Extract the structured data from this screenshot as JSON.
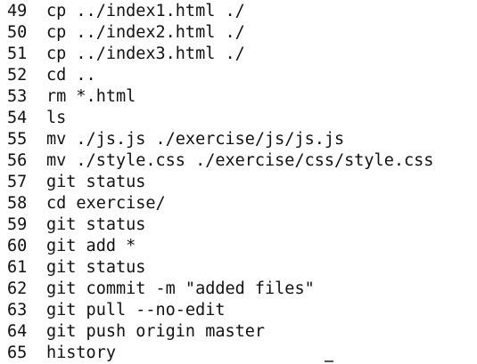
{
  "history": [
    {
      "num": "49",
      "cmd": "cp ../index1.html ./"
    },
    {
      "num": "50",
      "cmd": "cp ../index2.html ./"
    },
    {
      "num": "51",
      "cmd": "cp ../index3.html ./"
    },
    {
      "num": "52",
      "cmd": "cd .."
    },
    {
      "num": "53",
      "cmd": "rm *.html"
    },
    {
      "num": "54",
      "cmd": "ls"
    },
    {
      "num": "55",
      "cmd": "mv ./js.js ./exercise/js/js.js"
    },
    {
      "num": "56",
      "cmd": "mv ./style.css ./exercise/css/style.css"
    },
    {
      "num": "57",
      "cmd": "git status"
    },
    {
      "num": "58",
      "cmd": "cd exercise/"
    },
    {
      "num": "59",
      "cmd": "git status"
    },
    {
      "num": "60",
      "cmd": "git add *"
    },
    {
      "num": "61",
      "cmd": "git status"
    },
    {
      "num": "62",
      "cmd": "git commit -m \"added files\""
    },
    {
      "num": "63",
      "cmd": "git pull --no-edit"
    },
    {
      "num": "64",
      "cmd": "git push origin master"
    },
    {
      "num": "65",
      "cmd": "history"
    }
  ],
  "colors": {
    "background": "#ffffff",
    "text": "#111111"
  }
}
